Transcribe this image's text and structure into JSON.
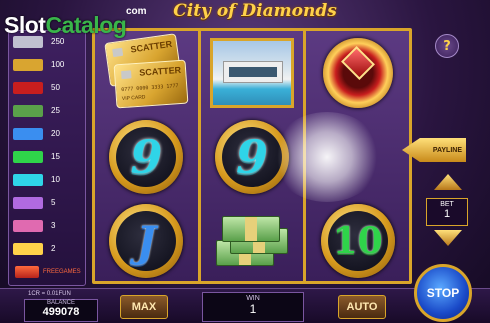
{
  "watermark": {
    "main_a": "Slot",
    "main_b": "Catalog",
    "com": "com"
  },
  "game": {
    "title": "City of Diamonds"
  },
  "paytable": {
    "rows": [
      {
        "value": "250",
        "color": "#c0c0d0"
      },
      {
        "value": "100",
        "color": "#d9a530"
      },
      {
        "value": "50",
        "color": "#c81e1e"
      },
      {
        "value": "25",
        "color": "#5aa04a"
      },
      {
        "value": "20",
        "color": "#3a8ef0"
      },
      {
        "value": "15",
        "color": "#2fd44a"
      },
      {
        "value": "10",
        "color": "#2fd4e8"
      },
      {
        "value": "5",
        "color": "#b06ae0"
      },
      {
        "value": "3",
        "color": "#e06ab0"
      },
      {
        "value": "2",
        "color": "#ffd24a"
      }
    ],
    "free_games": "FREEGAMES"
  },
  "reels": [
    [
      "scatter",
      "nine",
      "jack"
    ],
    [
      "house",
      "nine",
      "money"
    ],
    [
      "ring",
      "sparkle",
      "ten"
    ]
  ],
  "symbols": {
    "scatter_label": "SCATTER",
    "card_number": "0777 0000 3333 1777",
    "card_vip": "VIP CARD",
    "nine": "9",
    "jack": "J",
    "ten": "10"
  },
  "controls": {
    "help": "?",
    "payline": "PAYLINE",
    "bet_label": "BET",
    "bet_value": "1",
    "max": "MAX",
    "auto": "AUTO",
    "stop": "STOP"
  },
  "status": {
    "info": "1CR = 0.01FUN",
    "balance_label": "BALANCE",
    "balance_value": "499078",
    "win_label": "WIN",
    "win_value": "1"
  }
}
